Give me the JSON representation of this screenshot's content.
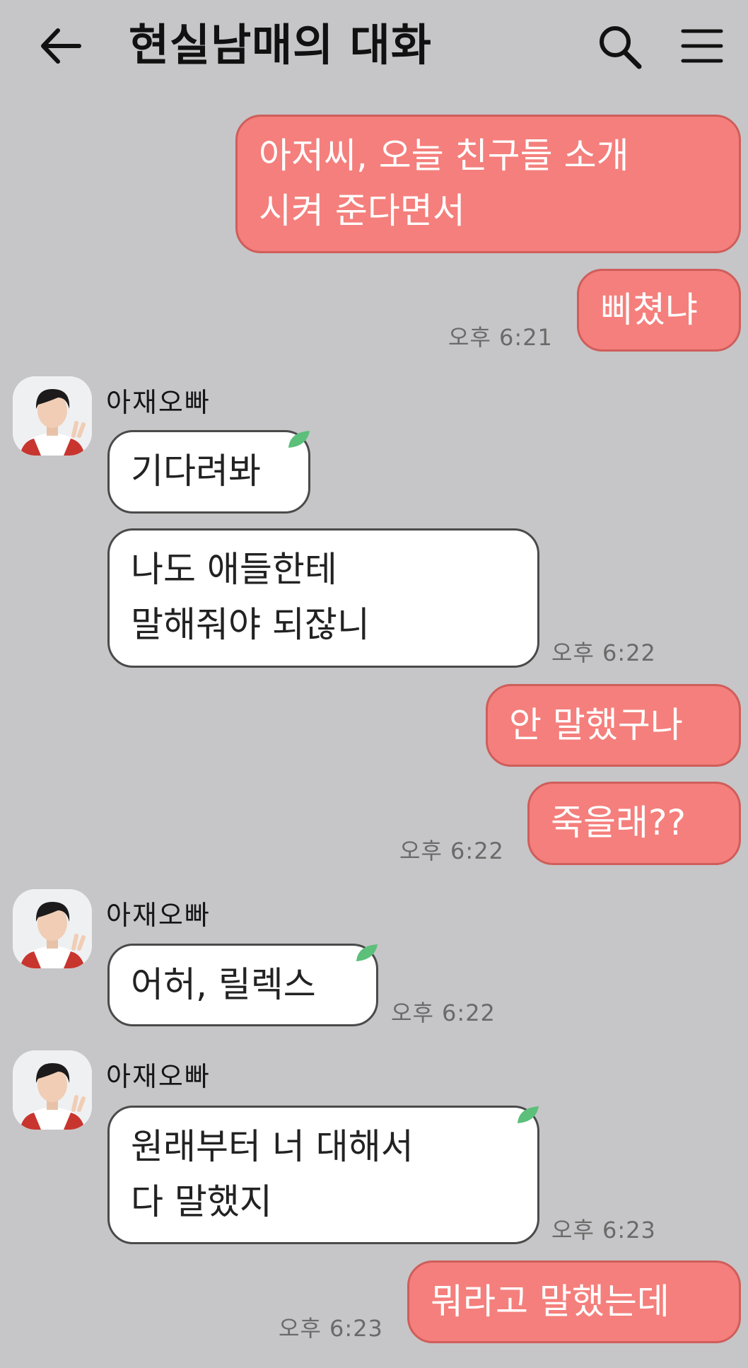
{
  "header": {
    "title": "현실남매의 대화",
    "back_icon": "arrow-left-icon",
    "search_icon": "search-icon",
    "menu_icon": "hamburger-menu-icon"
  },
  "colors": {
    "background": "#c6c6c8",
    "my_bubble": "#f47f7c",
    "their_bubble": "#ffffff",
    "timestamp": "#6a6a6a",
    "leaf": "#5cbf7a"
  },
  "messages": [
    {
      "from": "me",
      "text": "아저씨, 오늘 친구들 소개\n시켜 준다면서"
    },
    {
      "from": "me",
      "text": "삐쳤냐",
      "time": "오후 6:21"
    },
    {
      "sender": "아재오빠",
      "from": "them",
      "text": "기다려봐"
    },
    {
      "from": "them",
      "text": "나도 애들한테\n말해줘야 되잖니",
      "time": "오후 6:22"
    },
    {
      "from": "me",
      "text": "안 말했구나"
    },
    {
      "from": "me",
      "text": "죽을래??",
      "time": "오후 6:22"
    },
    {
      "sender": "아재오빠",
      "from": "them",
      "text": "어허, 릴렉스",
      "time": "오후 6:22"
    },
    {
      "sender": "아재오빠",
      "from": "them",
      "text": "원래부터 너 대해서\n다 말했지",
      "time": "오후 6:23"
    },
    {
      "from": "me",
      "text": "뭐라고 말했는데",
      "time": "오후 6:23"
    }
  ]
}
